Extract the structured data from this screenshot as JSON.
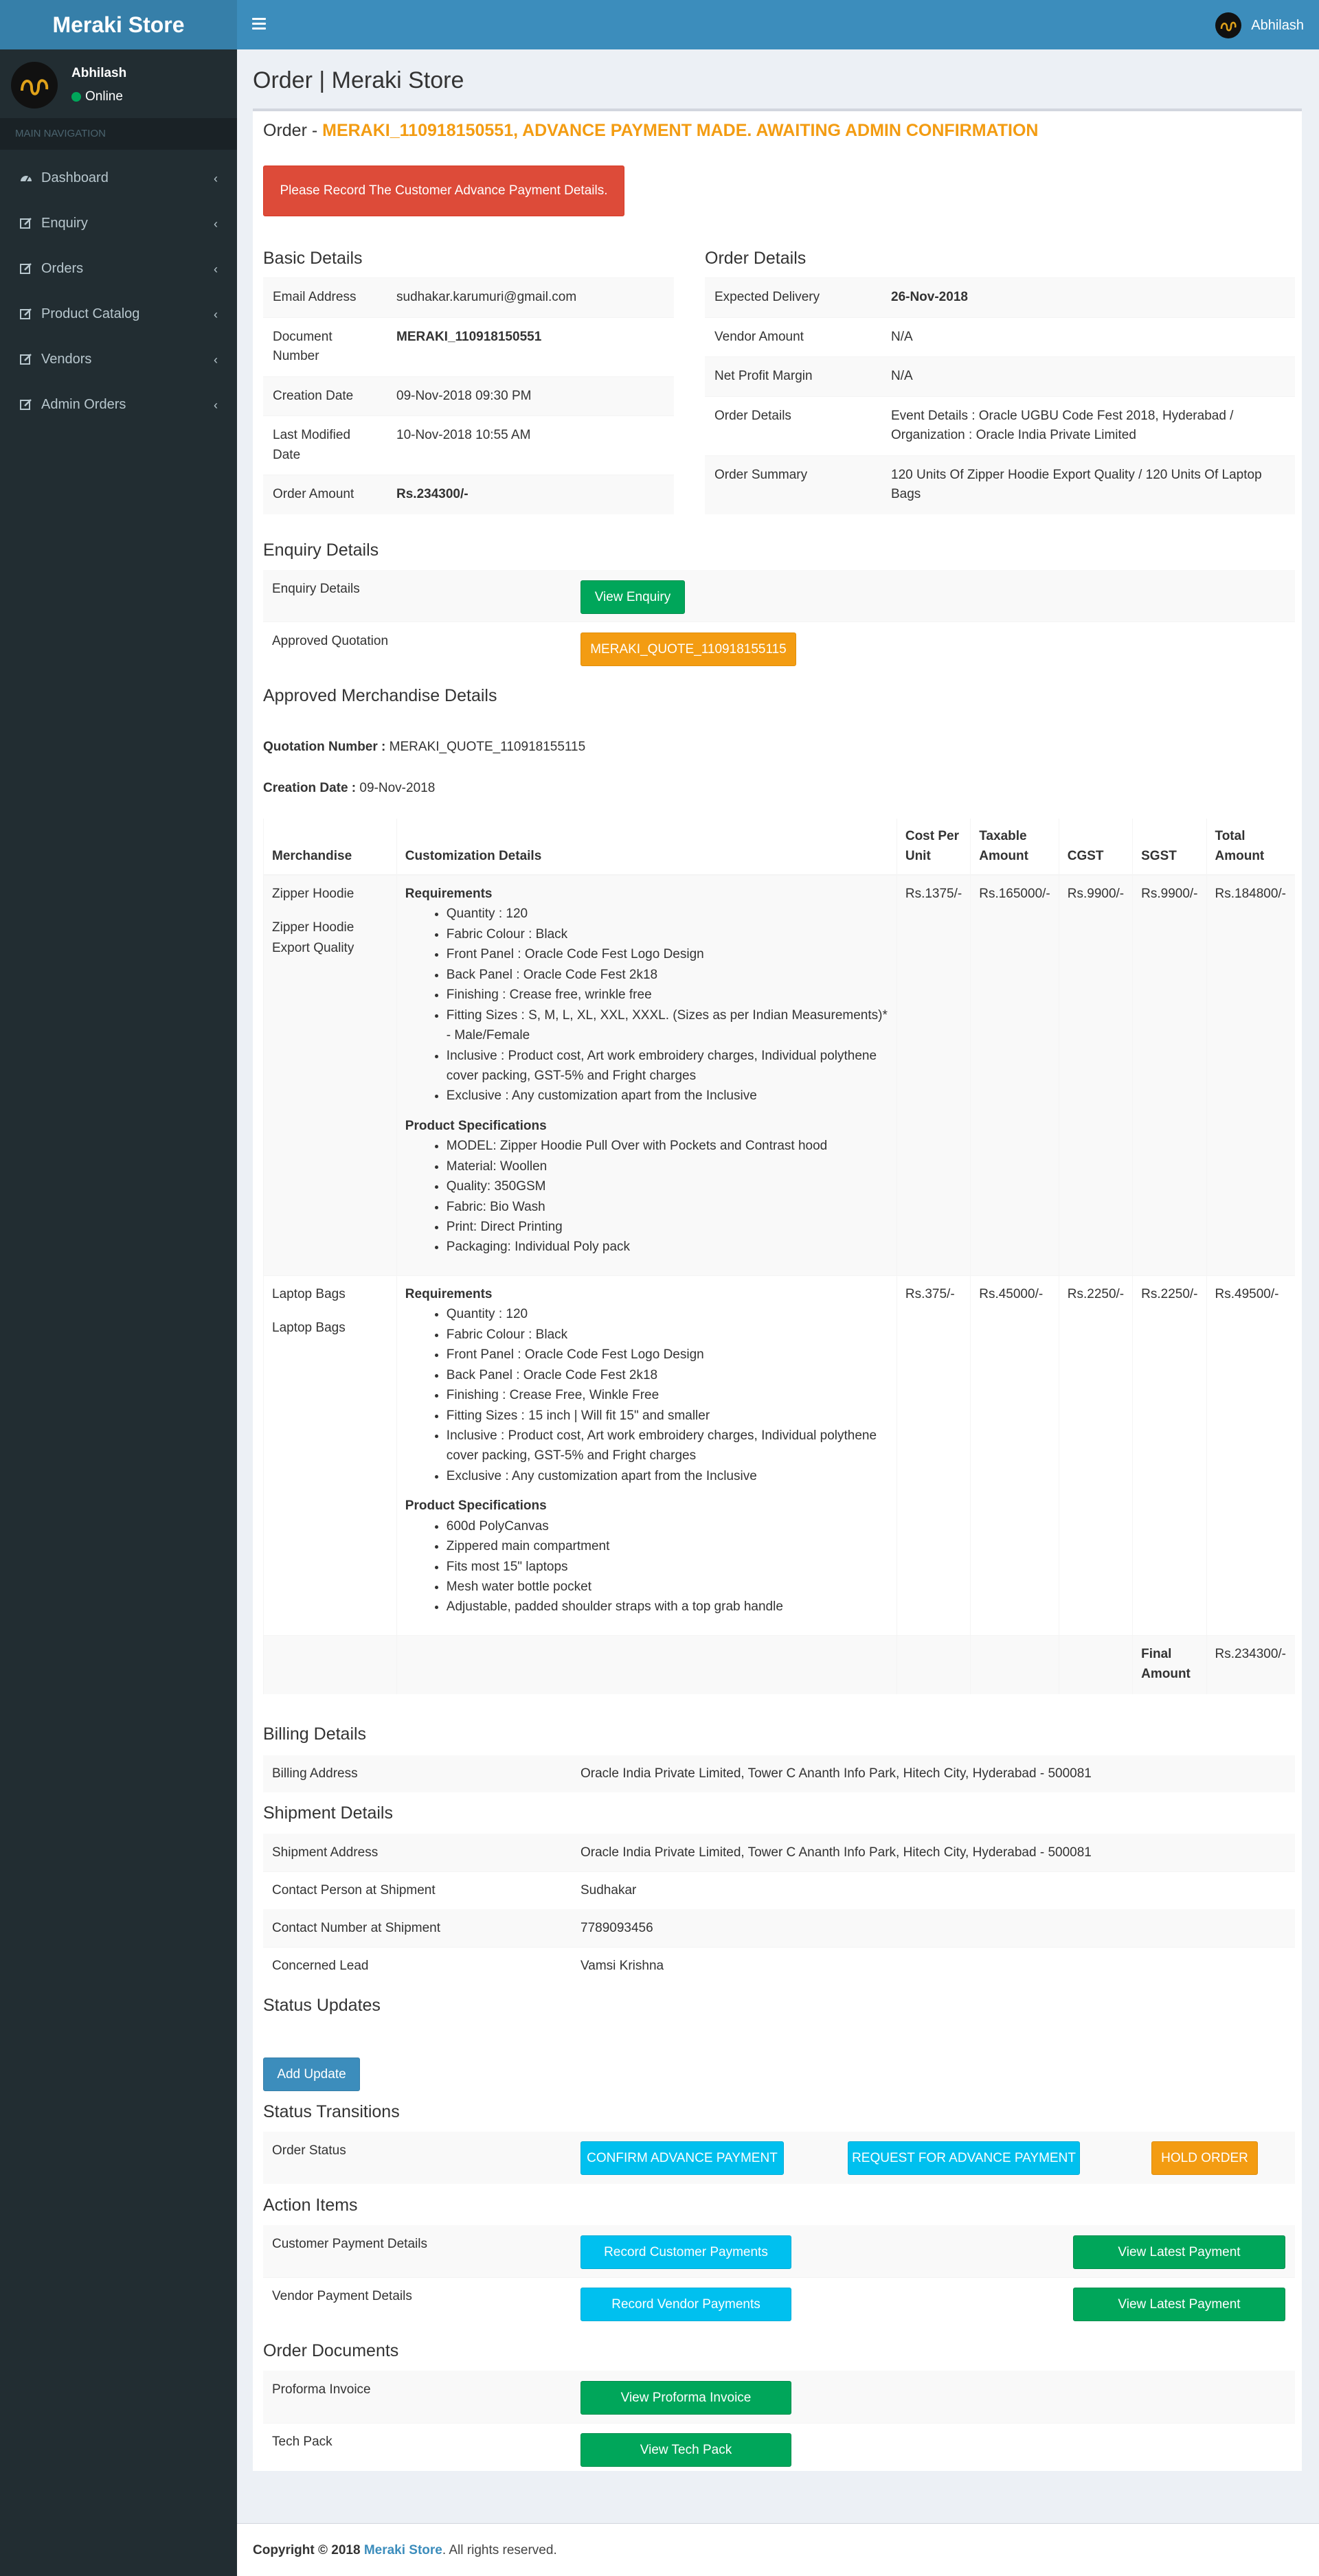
{
  "app": {
    "logo": "Meraki Store",
    "user_name": "Abhilash"
  },
  "sidebar": {
    "user_name": "Abhilash",
    "status": "Online",
    "header": "MAIN NAVIGATION",
    "items": [
      {
        "label": "Dashboard",
        "icon": "dashboard-icon"
      },
      {
        "label": "Enquiry",
        "icon": "edit-icon"
      },
      {
        "label": "Orders",
        "icon": "edit-icon"
      },
      {
        "label": "Product Catalog",
        "icon": "edit-icon"
      },
      {
        "label": "Vendors",
        "icon": "edit-icon"
      },
      {
        "label": "Admin Orders",
        "icon": "edit-icon"
      }
    ]
  },
  "page": {
    "title": "Order | Meraki Store",
    "order_prefix": "Order - ",
    "order_status": "MERAKI_110918150551, ADVANCE PAYMENT MADE. AWAITING ADMIN CONFIRMATION",
    "alert_button": "Please Record The Customer Advance Payment Details."
  },
  "basic_details": {
    "heading": "Basic Details",
    "rows": [
      {
        "label": "Email Address",
        "value": "sudhakar.karumuri@gmail.com"
      },
      {
        "label": "Document Number",
        "value": "MERAKI_110918150551"
      },
      {
        "label": "Creation Date",
        "value": "09-Nov-2018 09:30 PM"
      },
      {
        "label": "Last Modified Date",
        "value": "10-Nov-2018 10:55 AM"
      },
      {
        "label": "Order Amount",
        "value": "Rs.234300/-"
      }
    ]
  },
  "order_details": {
    "heading": "Order Details",
    "rows": [
      {
        "label": "Expected Delivery",
        "value": "26-Nov-2018"
      },
      {
        "label": "Vendor Amount",
        "value": "N/A"
      },
      {
        "label": "Net Profit Margin",
        "value": "N/A"
      },
      {
        "label": "Order Details",
        "value": "Event Details : Oracle UGBU Code Fest 2018, Hyderabad / Organization : Oracle India Private Limited"
      },
      {
        "label": "Order Summary",
        "value": "120 Units Of Zipper Hoodie Export Quality / 120 Units Of Laptop Bags"
      }
    ]
  },
  "enquiry_details": {
    "heading": "Enquiry Details",
    "enquiry_label": "Enquiry Details",
    "enquiry_button": "View Enquiry",
    "quotation_label": "Approved Quotation",
    "quotation_button": "MERAKI_QUOTE_110918155115"
  },
  "merchandise": {
    "heading": "Approved Merchandise Details",
    "quotation_label": "Quotation Number :",
    "quotation_value": "MERAKI_QUOTE_110918155115",
    "creation_label": "Creation Date :",
    "creation_value": "09-Nov-2018",
    "columns": [
      "Merchandise",
      "Customization Details",
      "Cost Per Unit",
      "Taxable Amount",
      "CGST",
      "SGST",
      "Total Amount"
    ],
    "rows": [
      {
        "name": "Zipper Hoodie",
        "variant": "Zipper Hoodie Export Quality",
        "req_heading": "Requirements",
        "requirements": [
          "Quantity : 120",
          "Fabric Colour : Black",
          "Front Panel : Oracle Code Fest Logo Design",
          "Back Panel : Oracle Code Fest 2k18",
          "Finishing : Crease free, wrinkle free",
          "Fitting Sizes : S, M, L, XL, XXL, XXXL. (Sizes as per Indian Measurements)* - Male/Female",
          "Inclusive : Product cost, Art work embroidery charges, Individual polythene cover packing, GST-5% and Fright charges",
          "Exclusive : Any customization apart from the Inclusive"
        ],
        "spec_heading": "Product Specifications",
        "specs": [
          "MODEL: Zipper Hoodie Pull Over with Pockets and Contrast hood",
          "Material: Woollen",
          "Quality: 350GSM",
          "Fabric: Bio Wash",
          "Print: Direct Printing",
          "Packaging: Individual Poly pack"
        ],
        "cost": "Rs.1375/-",
        "taxable": "Rs.165000/-",
        "cgst": "Rs.9900/-",
        "sgst": "Rs.9900/-",
        "total": "Rs.184800/-"
      },
      {
        "name": "Laptop Bags",
        "variant": "Laptop Bags",
        "req_heading": "Requirements",
        "requirements": [
          "Quantity : 120",
          "Fabric Colour : Black",
          "Front Panel : Oracle Code Fest Logo Design",
          "Back Panel : Oracle Code Fest 2k18",
          "Finishing : Crease Free, Winkle Free",
          "Fitting Sizes : 15 inch | Will fit 15\" and smaller",
          "Inclusive : Product cost, Art work embroidery charges, Individual polythene cover packing, GST-5% and Fright charges",
          "Exclusive : Any customization apart from the Inclusive"
        ],
        "spec_heading": "Product Specifications",
        "specs": [
          "600d PolyCanvas",
          "Zippered main compartment",
          "Fits most 15\" laptops",
          "Mesh water bottle pocket",
          "Adjustable, padded shoulder straps with a top grab handle"
        ],
        "cost": "Rs.375/-",
        "taxable": "Rs.45000/-",
        "cgst": "Rs.2250/-",
        "sgst": "Rs.2250/-",
        "total": "Rs.49500/-"
      }
    ],
    "final_label": "Final Amount",
    "final_value": "Rs.234300/-"
  },
  "billing": {
    "heading": "Billing Details",
    "label": "Billing Address",
    "value": "Oracle India Private Limited, Tower C Ananth Info Park, Hitech City, Hyderabad - 500081"
  },
  "shipment": {
    "heading": "Shipment Details",
    "rows": [
      {
        "label": "Shipment Address",
        "value": "Oracle India Private Limited, Tower C Ananth Info Park, Hitech City, Hyderabad - 500081"
      },
      {
        "label": "Contact Person at Shipment",
        "value": "Sudhakar"
      },
      {
        "label": "Contact Number at Shipment",
        "value": "7789093456"
      },
      {
        "label": "Concerned Lead",
        "value": "Vamsi Krishna"
      }
    ]
  },
  "status_updates": {
    "heading": "Status Updates",
    "add_button": "Add Update"
  },
  "status_transitions": {
    "heading": "Status Transitions",
    "label": "Order Status",
    "confirm_button": "CONFIRM ADVANCE PAYMENT",
    "request_button": "REQUEST FOR ADVANCE PAYMENT",
    "hold_button": "HOLD ORDER"
  },
  "action_items": {
    "heading": "Action Items",
    "customer_label": "Customer Payment Details",
    "customer_button": "Record Customer Payments",
    "customer_view": "View Latest Payment",
    "vendor_label": "Vendor Payment Details",
    "vendor_button": "Record Vendor Payments",
    "vendor_view": "View Latest Payment"
  },
  "documents": {
    "heading": "Order Documents",
    "proforma_label": "Proforma Invoice",
    "proforma_button": "View Proforma Invoice",
    "techpack_label": "Tech Pack",
    "techpack_button": "View Tech Pack"
  },
  "footer": {
    "copyright": "Copyright © 2018",
    "brand": "Meraki Store",
    "rights": ". All rights reserved."
  },
  "colors": {
    "topbar": "#3c8dbc",
    "sidebar": "#222d32",
    "accent_orange": "#f39c12",
    "danger": "#dd4b39",
    "success": "#00a65a",
    "info": "#00c0ef"
  }
}
